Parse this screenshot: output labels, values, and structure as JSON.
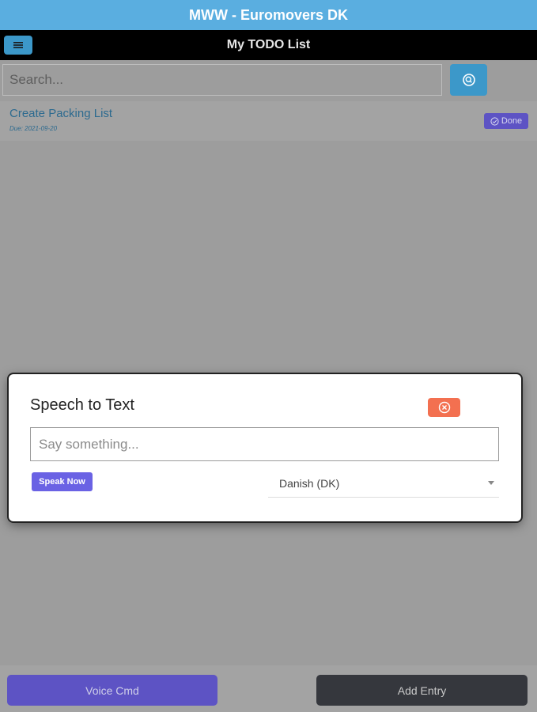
{
  "app": {
    "title": "MWW - Euromovers DK"
  },
  "navbar": {
    "title": "My TODO List",
    "menu_icon": "menu-icon"
  },
  "search": {
    "placeholder": "Search...",
    "button_icon": "search-icon"
  },
  "todos": [
    {
      "title": "Create Packing List",
      "due": "Due: 2021-09-20",
      "badge": "Done"
    }
  ],
  "modal": {
    "title": "Speech to Text",
    "input_placeholder": "Say something...",
    "speak_button": "Speak Now",
    "language": "Danish (DK)",
    "close_icon": "close-circle-icon"
  },
  "footer": {
    "voice_button": "Voice Cmd",
    "add_button": "Add Entry"
  },
  "colors": {
    "titlebar": "#5aaee0",
    "primary": "#3c98c9",
    "accent_purple": "#5d53c4",
    "close": "#f37050",
    "dark_button": "#35373d"
  }
}
